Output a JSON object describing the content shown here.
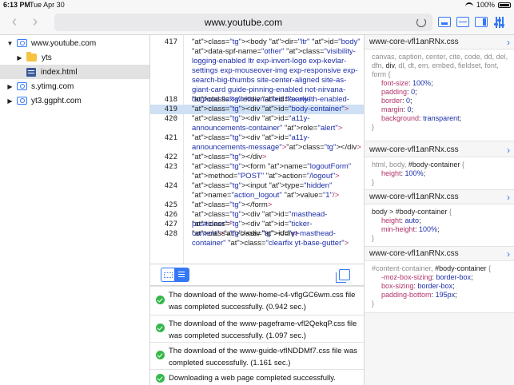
{
  "status_bar": {
    "time": "6:13 PM",
    "date": "Tue Apr 30",
    "battery": "100%"
  },
  "toolbar": {
    "url": "www.youtube.com"
  },
  "sidebar": {
    "items": [
      {
        "label": "www.youtube.com",
        "kind": "domain",
        "expanded": true,
        "indent": 0
      },
      {
        "label": "yts",
        "kind": "folder",
        "expanded": false,
        "indent": 1
      },
      {
        "label": "index.html",
        "kind": "file",
        "indent": 1,
        "selected": true
      },
      {
        "label": "s.ytimg.com",
        "kind": "domain",
        "expanded": false,
        "indent": 0
      },
      {
        "label": "yt3.ggpht.com",
        "kind": "domain",
        "expanded": false,
        "indent": 0
      }
    ]
  },
  "code": {
    "lines": [
      {
        "num": "417",
        "lines": 6,
        "text": "<body dir=\"ltr\" id=\"body\" data-spf-name=\"other\" class=\"visibility-logging-enabled ltr exp-invert-logo exp-kevlar-settings exp-mouseover-img exp-responsive exp-search-big-thumbs site-center-aligned site-as-giant-card guide-pinning-enabled not-nirvana-dogfood flex-width-enabled flex-width-enabled-snap delayed-frame-styles-not-in\">"
      },
      {
        "num": "418",
        "lines": 1,
        "text": "  <div id=\"early-body\"></div>"
      },
      {
        "num": "419",
        "lines": 1,
        "text": " <div id=\"body-container\">",
        "highlight": true
      },
      {
        "num": "420",
        "lines": 2,
        "text": "  <div id=\"a11y-announcements-container\" role=\"alert\">"
      },
      {
        "num": "421",
        "lines": 2,
        "text": "   <div id=\"a11y-announcements-message\"></div>"
      },
      {
        "num": "422",
        "lines": 1,
        "text": "  </div>"
      },
      {
        "num": "423",
        "lines": 2,
        "text": "  <form name=\"logoutForm\" method=\"POST\" action=\"/logout\">"
      },
      {
        "num": "424",
        "lines": 2,
        "text": "   <input type=\"hidden\" name=\"action_logout\" value=\"1\"/>"
      },
      {
        "num": "425",
        "lines": 1,
        "text": "  </form>"
      },
      {
        "num": "426",
        "lines": 1,
        "text": "  <div id=\"masthead-positioner\">"
      },
      {
        "num": "427",
        "lines": 1,
        "text": "   <div id=\"ticker-content\"></div>"
      },
      {
        "num": "428",
        "lines": 2,
        "text": "   <div id=\"yt-masthead-container\" class=\"clearfix yt-base-gutter\">"
      }
    ]
  },
  "console": {
    "messages": [
      "The download of the www-home-c4-vflgGC6wm.css file was completed successfully. (0.942 sec.)",
      "The download of the www-pageframe-vfl2QekqP.css file was completed successfully. (1.097 sec.)",
      "The download of the www-guide-vflNDDMf7.css file was completed successfully. (1.161 sec.)",
      "Downloading a web page completed successfully."
    ]
  },
  "styles": {
    "rules": [
      {
        "source": "www-core-vfl1anRNx.css",
        "selector_dim": "canvas, caption, center, cite, code, dd, del, dfn, ",
        "selector_match": "div",
        "selector_rest": ", dl, dt, em, embed, fieldset, font, form {",
        "props": [
          [
            "font-size",
            "100%"
          ],
          [
            "padding",
            "0"
          ],
          [
            "border",
            "0"
          ],
          [
            "margin",
            "0"
          ],
          [
            "background",
            "transparent"
          ]
        ]
      },
      {
        "source": "www-core-vfl1anRNx.css",
        "selector_dim": "html, body, ",
        "selector_match": "#body-container",
        "selector_rest": " {",
        "props": [
          [
            "height",
            "100%"
          ]
        ]
      },
      {
        "source": "www-core-vfl1anRNx.css",
        "selector_dim": "",
        "selector_match": "body > #body-container",
        "selector_rest": " {",
        "props": [
          [
            "height",
            "auto"
          ],
          [
            "min-height",
            "100%"
          ]
        ]
      },
      {
        "source": "www-core-vfl1anRNx.css",
        "selector_dim": "#content-container, ",
        "selector_match": "#body-container",
        "selector_rest": " {",
        "props": [
          [
            "-moz-box-sizing",
            "border-box"
          ],
          [
            "box-sizing",
            "border-box"
          ],
          [
            "padding-bottom",
            "195px"
          ]
        ]
      }
    ]
  }
}
